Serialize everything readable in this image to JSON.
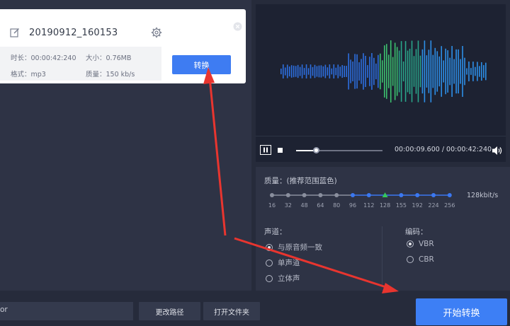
{
  "file": {
    "name": "20190912_160153",
    "duration_label": "时长：00:00:42:240",
    "size_label": "大小：0.76MB",
    "format_label": "格式：mp3",
    "quality_label": "质量：150 kb/s",
    "convert_label": "转换"
  },
  "player": {
    "time_text": "00:00:09.600 / 00:00:42:240",
    "progress": 0.227
  },
  "quality": {
    "label": "质量：(推荐范围蓝色)",
    "ticks": [
      "16",
      "32",
      "48",
      "64",
      "80",
      "96",
      "112",
      "128",
      "155",
      "192",
      "224",
      "256"
    ],
    "selected": "128",
    "value_text": "128kbit/s",
    "colors": {
      "gray": "#8a8f9e",
      "blue": "#3b78f0",
      "green": "#34c759"
    }
  },
  "channel": {
    "label": "声道：",
    "options": [
      "与原音频一致",
      "单声道",
      "立体声"
    ],
    "selected": "与原音频一致"
  },
  "encoding": {
    "label": "编码：",
    "options": [
      "VBR",
      "CBR"
    ],
    "selected": "VBR"
  },
  "bottom": {
    "path_text": "or",
    "change_path_label": "更改路径",
    "open_folder_label": "打开文件夹",
    "start_label": "开始转换"
  }
}
